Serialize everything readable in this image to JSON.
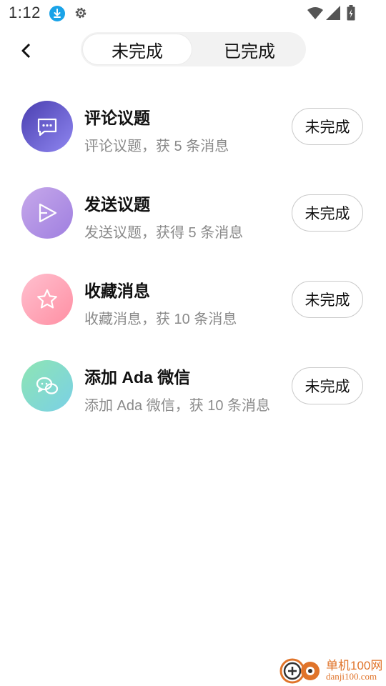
{
  "status_bar": {
    "time": "1:12",
    "icons": [
      "download-icon",
      "gear-icon",
      "wifi-icon",
      "signal-icon",
      "battery-icon"
    ]
  },
  "header": {
    "back_icon": "chevron-left-icon",
    "tabs": [
      {
        "label": "未完成",
        "active": true
      },
      {
        "label": "已完成",
        "active": false
      }
    ]
  },
  "tasks": [
    {
      "title": "评论议题",
      "desc": "评论议题，获 5 条消息",
      "button": "未完成",
      "icon": "comment-icon",
      "gradient": [
        "#4a3fb0",
        "#8f86f0"
      ]
    },
    {
      "title": "发送议题",
      "desc": "发送议题，获得 5 条消息",
      "button": "未完成",
      "icon": "send-icon",
      "gradient": [
        "#c6a8ea",
        "#9f7fe0"
      ]
    },
    {
      "title": "收藏消息",
      "desc": "收藏消息，获 10 条消息",
      "button": "未完成",
      "icon": "star-icon",
      "gradient": [
        "#ffc0cf",
        "#ff8fa3"
      ]
    },
    {
      "title": "添加 Ada 微信",
      "desc": "添加 Ada 微信，获 10 条消息",
      "button": "未完成",
      "icon": "wechat-icon",
      "gradient": [
        "#8ee5b3",
        "#7ad0e6"
      ]
    }
  ],
  "watermark": {
    "name": "单机100网",
    "url": "danji100.com",
    "accent": "#e0742a"
  }
}
